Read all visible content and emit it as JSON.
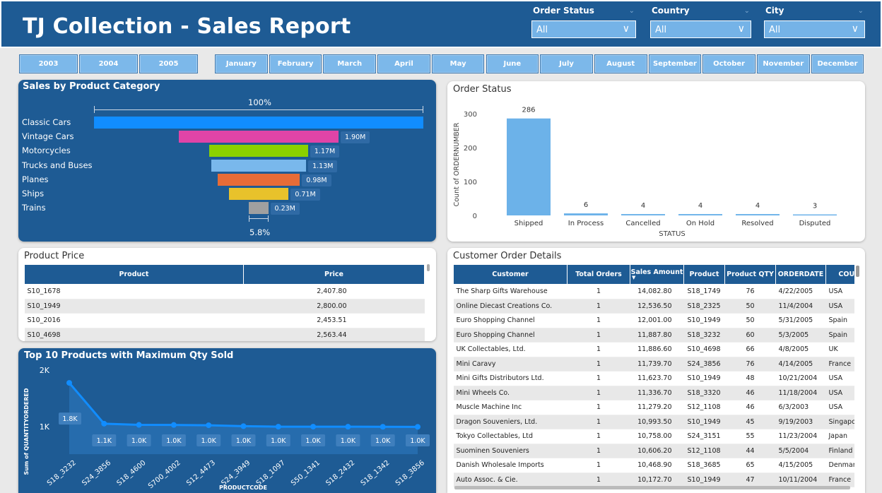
{
  "header": {
    "title": "TJ Collection - Sales Report",
    "order_status": {
      "label": "Order Status",
      "value": "All"
    },
    "country": {
      "label": "Country",
      "value": "All"
    },
    "city": {
      "label": "City",
      "value": "All"
    }
  },
  "years": [
    "2003",
    "2004",
    "2005"
  ],
  "months": [
    "January",
    "February",
    "March",
    "April",
    "May",
    "June",
    "July",
    "August",
    "September",
    "October",
    "November",
    "December"
  ],
  "category": {
    "title": "Sales by Product Category",
    "top_pct": "100%",
    "bottom_pct": "5.8%",
    "items": [
      {
        "name": "Classic Cars",
        "label": "",
        "color": "#118dff",
        "frac": 1.0
      },
      {
        "name": "Vintage Cars",
        "label": "1.90M",
        "color": "#e044a7",
        "frac": 0.485
      },
      {
        "name": "Motorcycles",
        "label": "1.17M",
        "color": "#8bd100",
        "frac": 0.3
      },
      {
        "name": "Trucks and Buses",
        "label": "1.13M",
        "color": "#79b8ec",
        "frac": 0.288
      },
      {
        "name": "Planes",
        "label": "0.98M",
        "color": "#e66c37",
        "frac": 0.25
      },
      {
        "name": "Ships",
        "label": "0.71M",
        "color": "#e8c22b",
        "frac": 0.182
      },
      {
        "name": "Trains",
        "label": "0.23M",
        "color": "#a0a0a0",
        "frac": 0.058
      }
    ]
  },
  "order_status_chart": {
    "title": "Order Status",
    "xlabel": "STATUS",
    "ylabel": "Count of ORDERNUMBER",
    "yticks": [
      "300",
      "200",
      "100",
      "0"
    ]
  },
  "product_price": {
    "title": "Product Price",
    "columns": [
      "Product",
      "Price"
    ],
    "rows": [
      [
        "S10_1678",
        "2,407.80"
      ],
      [
        "S10_1949",
        "2,800.00"
      ],
      [
        "S10_2016",
        "2,453.51"
      ],
      [
        "S10_4698",
        "2,563.44"
      ]
    ]
  },
  "top10": {
    "title": "Top 10 Products with Maximum Qty Sold",
    "xlabel": "PRODUCTCODE",
    "ylabel": "Sum of QUANTITYORDERED",
    "yticks": [
      "2K",
      "1K"
    ]
  },
  "customer_orders": {
    "title": "Customer Order Details",
    "columns": [
      "Customer",
      "Total Orders",
      "Sales Amount",
      "Product",
      "Product QTY",
      "ORDERDATE",
      "COUNT"
    ],
    "rows": [
      [
        "The Sharp Gifts Warehouse",
        "1",
        "14,082.80",
        "S18_1749",
        "76",
        "4/22/2005",
        "USA"
      ],
      [
        "Online Diecast Creations Co.",
        "1",
        "12,536.50",
        "S18_2325",
        "50",
        "11/4/2004",
        "USA"
      ],
      [
        "Euro Shopping Channel",
        "1",
        "12,001.00",
        "S10_1949",
        "50",
        "5/31/2005",
        "Spain"
      ],
      [
        "Euro Shopping Channel",
        "1",
        "11,887.80",
        "S18_3232",
        "60",
        "5/3/2005",
        "Spain"
      ],
      [
        "UK Collectables, Ltd.",
        "1",
        "11,886.60",
        "S10_4698",
        "66",
        "4/8/2005",
        "UK"
      ],
      [
        "Mini Caravy",
        "1",
        "11,739.70",
        "S24_3856",
        "76",
        "4/14/2005",
        "France"
      ],
      [
        "Mini Gifts Distributors Ltd.",
        "1",
        "11,623.70",
        "S10_1949",
        "48",
        "10/21/2004",
        "USA"
      ],
      [
        "Mini Wheels Co.",
        "1",
        "11,336.70",
        "S18_3320",
        "46",
        "11/18/2004",
        "USA"
      ],
      [
        "Muscle Machine Inc",
        "1",
        "11,279.20",
        "S12_1108",
        "46",
        "6/3/2003",
        "USA"
      ],
      [
        "Dragon Souveniers, Ltd.",
        "1",
        "10,993.50",
        "S10_1949",
        "45",
        "9/19/2003",
        "Singapo"
      ],
      [
        "Tokyo Collectables, Ltd",
        "1",
        "10,758.00",
        "S24_3151",
        "55",
        "11/23/2004",
        "Japan"
      ],
      [
        "Suominen Souveniers",
        "1",
        "10,606.20",
        "S12_1108",
        "44",
        "5/5/2004",
        "Finland"
      ],
      [
        "Danish Wholesale Imports",
        "1",
        "10,468.90",
        "S18_3685",
        "65",
        "4/15/2005",
        "Denmar"
      ],
      [
        "Auto Assoc. & Cie.",
        "1",
        "10,172.70",
        "S10_1949",
        "47",
        "10/11/2004",
        "France"
      ]
    ]
  },
  "chart_data": [
    {
      "type": "bar",
      "title": "Order Status",
      "xlabel": "STATUS",
      "ylabel": "Count of ORDERNUMBER",
      "categories": [
        "Shipped",
        "In Process",
        "Cancelled",
        "On Hold",
        "Resolved",
        "Disputed"
      ],
      "values": [
        286,
        6,
        4,
        4,
        4,
        3
      ],
      "ylim": [
        0,
        300
      ],
      "color": "#6cb2e9"
    },
    {
      "type": "line",
      "title": "Top 10 Products with Maximum Qty Sold",
      "xlabel": "PRODUCTCODE",
      "ylabel": "Sum of QUANTITYORDERED",
      "categories": [
        "S18_3232",
        "S24_3856",
        "S18_4600",
        "S700_4002",
        "S12_4473",
        "S24_3949",
        "S18_1097",
        "S50_1341",
        "S18_2432",
        "S18_1342",
        "S18_3856"
      ],
      "values": [
        1774,
        1052,
        1031,
        1029,
        1024,
        1008,
        999,
        999,
        998,
        997,
        996
      ],
      "labels": [
        "1.8K",
        "1.1K",
        "1.0K",
        "1.0K",
        "1.0K",
        "1.0K",
        "1.0K",
        "1.0K",
        "1.0K",
        "1.0K",
        "1.0K"
      ],
      "ylim": [
        0,
        2000
      ],
      "color": "#118dff"
    }
  ]
}
